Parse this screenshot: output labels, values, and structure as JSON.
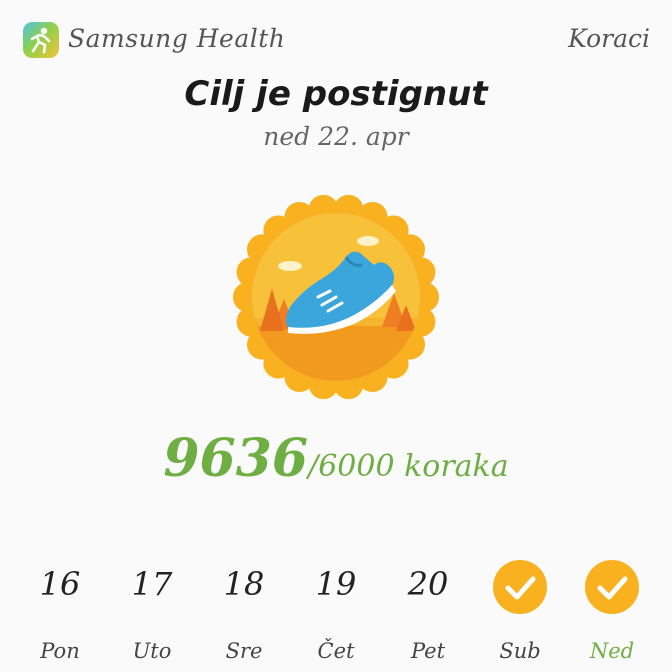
{
  "header": {
    "app_name": "Samsung Health",
    "section": "Koraci"
  },
  "goal": {
    "title": "Cilj je postignut",
    "date": "ned 22. apr",
    "steps": "9636",
    "target": "/6000 koraka"
  },
  "week": {
    "days": [
      {
        "num": "16",
        "name": "Pon",
        "achieved": false
      },
      {
        "num": "17",
        "name": "Uto",
        "achieved": false
      },
      {
        "num": "18",
        "name": "Sre",
        "achieved": false
      },
      {
        "num": "19",
        "name": "Čet",
        "achieved": false
      },
      {
        "num": "20",
        "name": "Pet",
        "achieved": false
      },
      {
        "num": "",
        "name": "Sub",
        "achieved": true
      },
      {
        "num": "",
        "name": "Ned",
        "achieved": true,
        "selected": true
      }
    ]
  },
  "colors": {
    "accent_green": "#6fae43",
    "badge_gold": "#f9b11f",
    "shoe_blue": "#3aa6dc"
  },
  "icons": {
    "logo": "samsung-health-logo-icon",
    "badge": "running-shoe-badge-icon",
    "check": "check-icon"
  }
}
